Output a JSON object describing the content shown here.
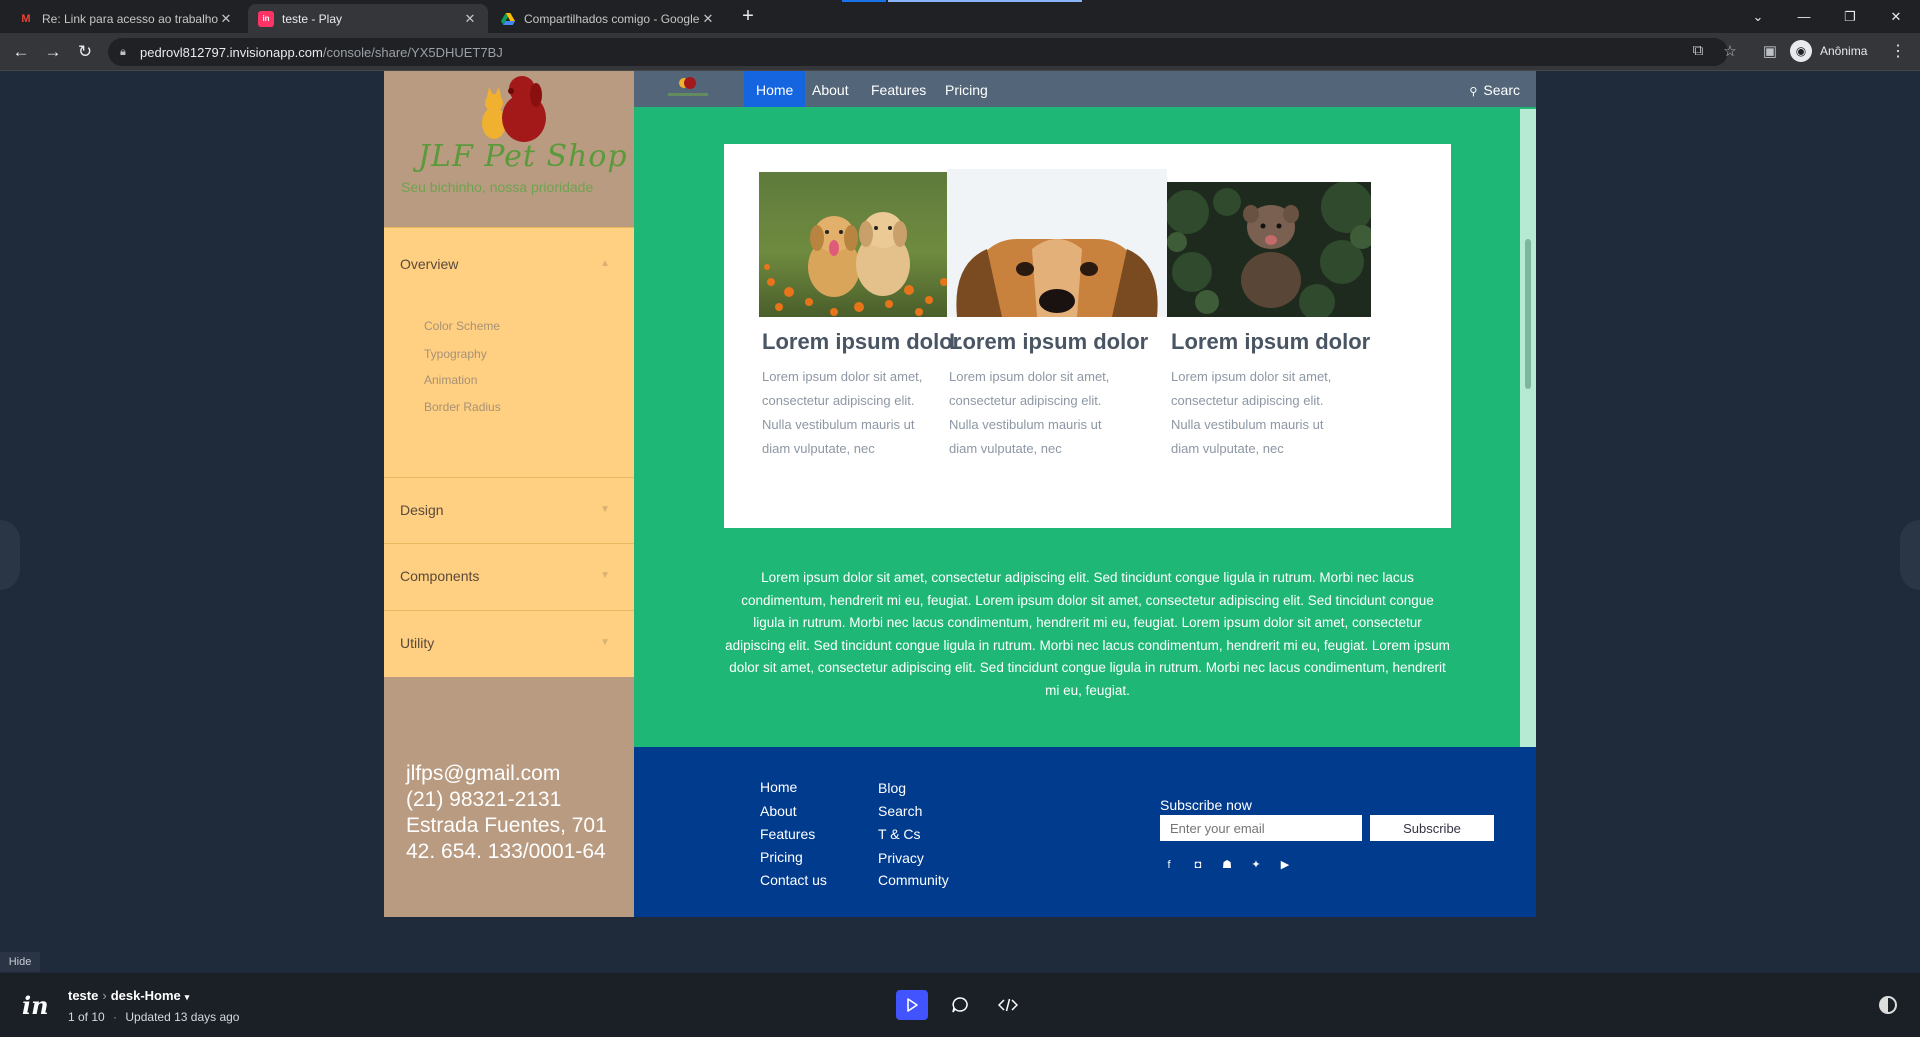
{
  "browser": {
    "tabs": [
      {
        "title": "Re: Link para acesso ao trabalho",
        "icon": "gmail-icon",
        "active": false
      },
      {
        "title": "teste - Play",
        "icon": "invision-icon",
        "active": true
      },
      {
        "title": "Compartilhados comigo - Google",
        "icon": "google-drive-icon",
        "active": false
      }
    ],
    "url_host": "pedrovl812797.invisionapp.com",
    "url_path": "/console/share/YX5DHUET7BJ",
    "profile_label": "Anônima"
  },
  "site": {
    "brand": {
      "title": "JLF Pet Shop",
      "subtitle": "Seu bichinho, nossa prioridade"
    },
    "sidebar": {
      "sections": [
        {
          "label": "Overview",
          "expanded": true,
          "items": [
            "Color Scheme",
            "Typography",
            "Animation",
            "Border Radius"
          ]
        },
        {
          "label": "Design",
          "expanded": false
        },
        {
          "label": "Components",
          "expanded": false
        },
        {
          "label": "Utility",
          "expanded": false
        }
      ],
      "contact": {
        "email": "jlfps@gmail.com",
        "phone": "(21) 98321-2131",
        "address": "Estrada Fuentes, 701",
        "cnpj": "42. 654. 133/0001-64"
      }
    },
    "topnav": {
      "links": [
        "Home",
        "About",
        "Features",
        "Pricing"
      ],
      "active": "Home",
      "search_label": "Searc"
    },
    "cards": [
      {
        "title": "Lorem ipsum dolor",
        "text": "Lorem ipsum dolor sit amet, consectetur adipiscing elit. Nulla vestibulum mauris ut diam vulputate, nec",
        "image": "two golden puppies in flower field"
      },
      {
        "title": "Lorem ipsum dolor",
        "text": "Lorem ipsum dolor sit amet, consectetur adipiscing elit. Nulla vestibulum mauris ut diam vulputate, nec",
        "image": "dog face peeking"
      },
      {
        "title": "Lorem ipsum dolor",
        "text": "Lorem ipsum dolor sit amet, consectetur adipiscing elit. Nulla vestibulum mauris ut diam vulputate, nec",
        "image": "terrier in dark foliage"
      }
    ],
    "paragraph": "Lorem ipsum dolor sit amet, consectetur adipiscing elit. Sed tincidunt congue ligula in rutrum. Morbi nec lacus condimentum, hendrerit mi eu, feugiat. Lorem ipsum dolor sit amet, consectetur adipiscing elit. Sed tincidunt congue ligula in rutrum. Morbi nec lacus condimentum, hendrerit mi eu, feugiat.  Lorem ipsum dolor sit amet, consectetur adipiscing elit. Sed tincidunt congue ligula in rutrum. Morbi nec lacus condimentum, hendrerit mi eu, feugiat.  Lorem ipsum dolor sit amet, consectetur adipiscing elit. Sed tincidunt congue ligula in rutrum. Morbi nec lacus condimentum, hendrerit mi eu, feugiat.",
    "footer": {
      "col1": [
        "Home",
        "About",
        "Features",
        "Pricing",
        "Contact us"
      ],
      "col2": [
        "Blog",
        "Search",
        "T & Cs",
        "Privacy",
        "Community"
      ],
      "subscribe_title": "Subscribe now",
      "email_placeholder": "Enter your email",
      "subscribe_button": "Subscribe",
      "social_icons": [
        "facebook-icon",
        "instagram-icon",
        "snapchat-icon",
        "twitter-icon",
        "youtube-icon"
      ]
    }
  },
  "invision": {
    "hide_label": "Hide",
    "project": "teste",
    "screen": "desk-Home",
    "position": "1 of 10",
    "updated": "Updated 13 days ago"
  },
  "colors": {
    "sidebar_bg": "#b99b81",
    "accordion_bg": "#ffcf82",
    "main_bg": "#1fb776",
    "topnav_bg": "#536578",
    "active_nav": "#1565e0",
    "footer_bg": "#003b8e",
    "play_button": "#4254ff"
  }
}
